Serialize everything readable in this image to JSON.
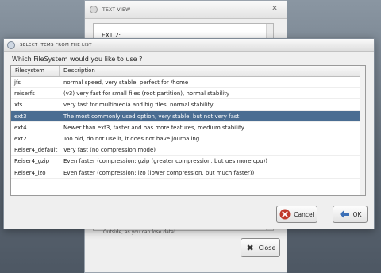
{
  "background_window": {
    "title": "TEXT VIEW",
    "text_line_1": "EXT 2:",
    "text_line_bottom": "Outside, as you can lose data!",
    "close_label": "Close"
  },
  "dialog": {
    "title": "SELECT ITEMS FROM THE LIST",
    "question": "Which FileSystem would you like to use ?",
    "columns": [
      "Filesystem",
      "Description"
    ],
    "rows": [
      {
        "fs": "jfs",
        "desc": "normal speed, very stable, perfect for /home"
      },
      {
        "fs": "reiserfs",
        "desc": "(v3) very fast for small files (root partition), normal stability"
      },
      {
        "fs": "xfs",
        "desc": "very fast for multimedia and big files, normal stability"
      },
      {
        "fs": "ext3",
        "desc": "The most commonly used option, very stable, but not very fast"
      },
      {
        "fs": "ext4",
        "desc": "Newer than ext3, faster and has more features, medium stability"
      },
      {
        "fs": "ext2",
        "desc": "Too old, do not use it, it does not have journaling"
      },
      {
        "fs": "Reiser4_default",
        "desc": "Very fast (no compression mode)"
      },
      {
        "fs": "Reiser4_gzip",
        "desc": "Even faster (compression: gzip (greater compression, but ues more cpu))"
      },
      {
        "fs": "Reiser4_lzo",
        "desc": "Even faster (compression: lzo (lower compression, but much faster))"
      }
    ],
    "selected_index": 3,
    "cancel_label": "Cancel",
    "ok_label": "OK"
  },
  "colors": {
    "selection": "#4a6d92",
    "cancel_icon": "#c0392b",
    "ok_icon": "#3b6fb6"
  },
  "icons": [
    "window-icon",
    "close-icon",
    "cancel-icon",
    "ok-icon"
  ]
}
